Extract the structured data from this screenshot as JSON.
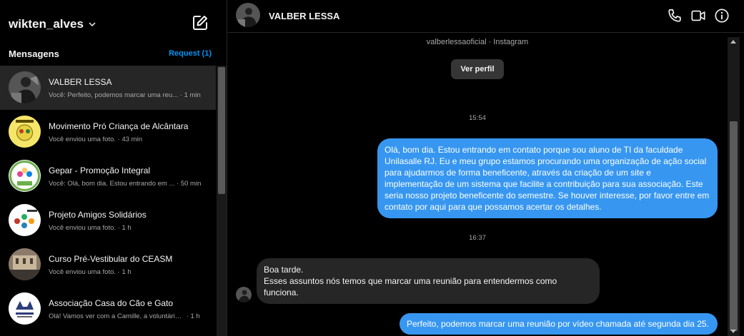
{
  "sidebar": {
    "account_name": "wikten_alves",
    "section_title": "Mensagens",
    "request_label": "Request (1)",
    "conversations": [
      {
        "name": "VALBER LESSA",
        "snippet": "Você: Perfeito, podemos marcar uma reu...",
        "time": "· 1 min",
        "active": true,
        "avatar_icon": "person-photo-avatar"
      },
      {
        "name": "Movimento Pró Criança de Alcântara",
        "snippet": "Você enviou uma foto.",
        "time": "· 43 min",
        "active": false,
        "avatar_icon": "yellow-logo-avatar"
      },
      {
        "name": "Gepar - Promoção Integral",
        "snippet": "Você: Olá, bom dia. Estou entrando em ...",
        "time": "· 50 min",
        "active": false,
        "avatar_icon": "gepar-logo-avatar"
      },
      {
        "name": "Projeto Amigos Solidários",
        "snippet": "Você enviou uma foto.",
        "time": "· 1 h",
        "active": false,
        "avatar_icon": "amigos-logo-avatar"
      },
      {
        "name": "Curso Pré-Vestibular do CEASM",
        "snippet": "Você enviou uma foto.",
        "time": "· 1 h",
        "active": false,
        "avatar_icon": "building-photo-avatar"
      },
      {
        "name": "Associação Casa do Cão e Gato",
        "snippet": "Olá! Vamos ver com a Camille, a voluntária ...",
        "time": "· 1 h",
        "active": false,
        "avatar_icon": "dog-cat-logo-avatar"
      }
    ]
  },
  "chat": {
    "contact_name": "VALBER LESSA",
    "source_line": "valberlessaoficial · Instagram",
    "view_profile_label": "Ver perfil",
    "timestamp_1": "15:54",
    "message_out_1": "Olá, bom dia. Estou entrando em contato porque sou aluno de TI da faculdade Unilasalle RJ. Eu e meu grupo estamos procurando uma organização de ação social para ajudarmos de forma beneficente, através da criação de um site e implementação de um sistema que facilite a contribuição para sua associação. Este seria nosso projeto beneficente do semestre. Se houver interesse, por favor entre em contato por aqui para que possamos acertar os detalhes.",
    "timestamp_2": "16:37",
    "message_in_1": "Boa tarde.\nEsses assuntos nós temos que marcar uma reunião para entendermos como funciona.",
    "message_out_2": "Perfeito, podemos marcar uma reunião por vídeo chamada até segunda dia 25."
  },
  "colors": {
    "outgoing_bubble": "#3797f0",
    "incoming_bubble": "#262626",
    "accent_link": "#0095f6",
    "background": "#000000"
  }
}
